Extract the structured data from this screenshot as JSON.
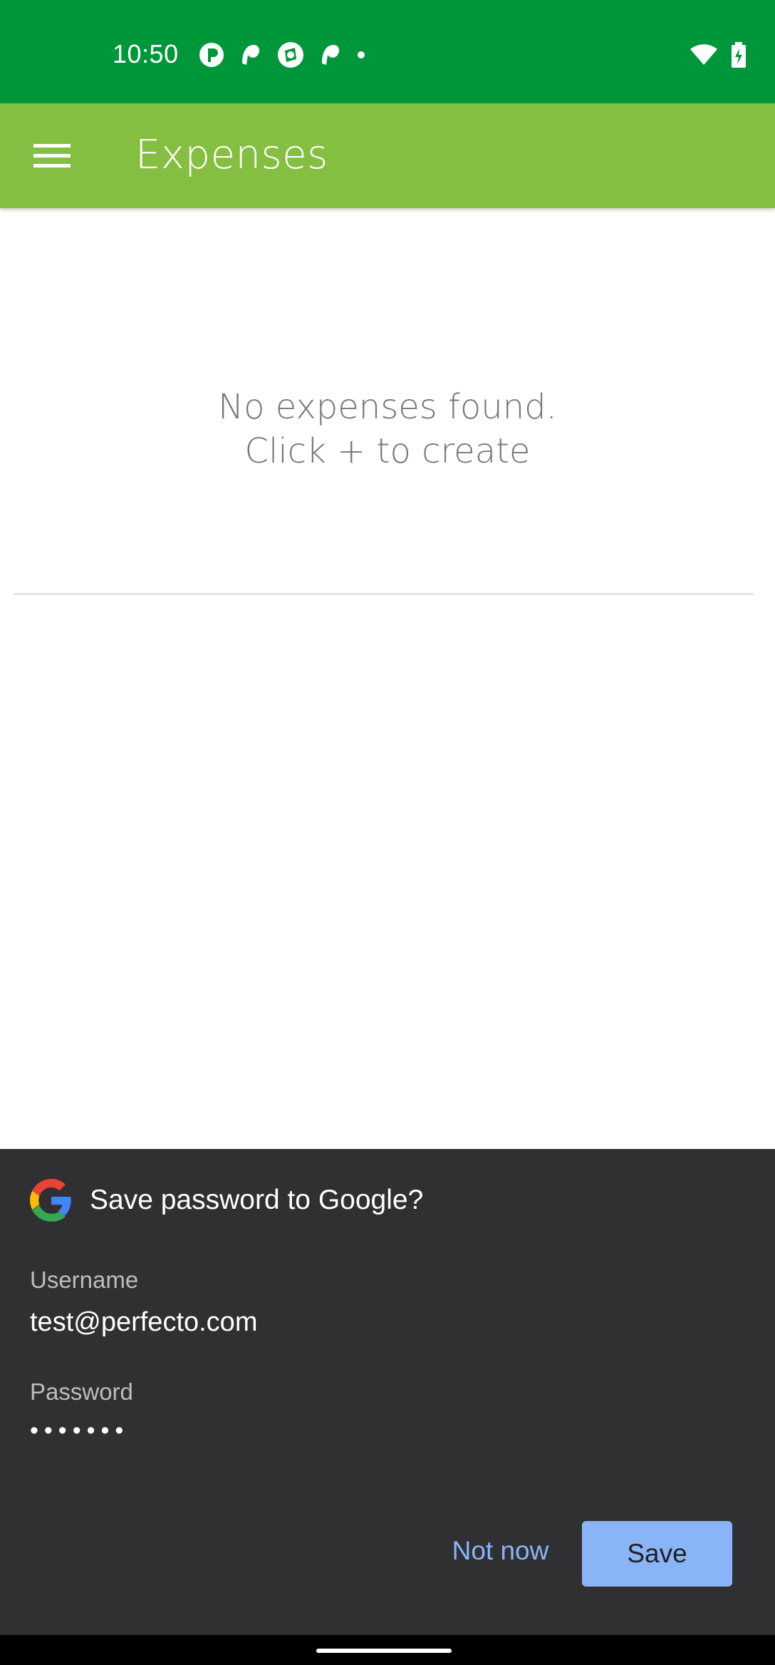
{
  "status_bar": {
    "time": "10:50",
    "notification_icons": [
      "app-notification-icon",
      "app-notification-icon",
      "app-notification-icon",
      "app-notification-icon",
      "dot-icon"
    ],
    "wifi_icon": "wifi-icon",
    "battery_icon": "battery-charging-icon",
    "color": "#00973a"
  },
  "app_bar": {
    "title": "Expenses",
    "menu_icon": "hamburger-menu-icon",
    "color": "#84bf41"
  },
  "empty_state": {
    "line1": "No expenses found.",
    "line2": "Click + to create"
  },
  "save_password_sheet": {
    "title": "Save password to Google?",
    "username_label": "Username",
    "username_value": "test@perfecto.com",
    "password_label": "Password",
    "password_value": "•••••••",
    "not_now_label": "Not now",
    "save_label": "Save",
    "accent_color": "#8ab4f8",
    "background_color": "#303032"
  }
}
